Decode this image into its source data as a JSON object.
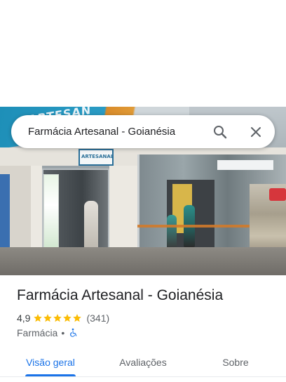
{
  "search": {
    "query": "Farmácia Artesanal - Goianésia"
  },
  "photo": {
    "sign_text": "ARTESAN",
    "small_sign_text": "ARTESANAL"
  },
  "place": {
    "name": "Farmácia Artesanal - Goianésia",
    "rating": "4,9",
    "rating_stars": 5,
    "review_count": "(341)",
    "category": "Farmácia",
    "separator": "•",
    "accessibility_icon": "wheelchair-icon"
  },
  "tabs": [
    {
      "label": "Visão geral",
      "selected": true
    },
    {
      "label": "Avaliações",
      "selected": false
    },
    {
      "label": "Sobre",
      "selected": false
    }
  ],
  "colors": {
    "accent": "#1a73e8",
    "star": "#fbbc04",
    "text_primary": "#202124",
    "text_secondary": "#5f6368"
  }
}
